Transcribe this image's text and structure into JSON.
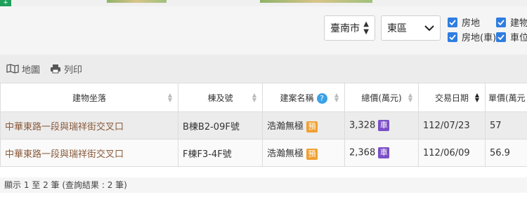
{
  "colors": {
    "checkbox": "#2f7de1",
    "pre_sale_badge": "#f0a030",
    "parking_badge": "#7b4fc7",
    "help_icon": "#3aa0e8",
    "address_link": "#8a5a3b"
  },
  "filters": {
    "city": "臺南市",
    "district": "東區",
    "checkboxes": [
      "房地",
      "房地(車)",
      "建物",
      "車位"
    ]
  },
  "toolbar": {
    "map_label": "地圖",
    "print_label": "列印"
  },
  "table": {
    "columns": [
      "建物坐落",
      "棟及號",
      "建案名稱",
      "總價(萬元)",
      "交易日期",
      "單價(萬元"
    ],
    "rows": [
      {
        "address": "中華東路一段與瑞祥街交叉口",
        "unit": "B棟B2-09F號",
        "project": "浩瀚無極",
        "project_badge": "預",
        "price": "3,328",
        "price_badge": "車",
        "date": "112/07/23",
        "unit_price": "57"
      },
      {
        "address": "中華東路一段與瑞祥街交叉口",
        "unit": "F棟F3-4F號",
        "project": "浩瀚無極",
        "project_badge": "預",
        "price": "2,368",
        "price_badge": "車",
        "date": "112/06/09",
        "unit_price": "56.9"
      }
    ]
  },
  "footer": {
    "summary": "顯示 1 至 2 筆 (查詢結果 : 2 筆)"
  }
}
